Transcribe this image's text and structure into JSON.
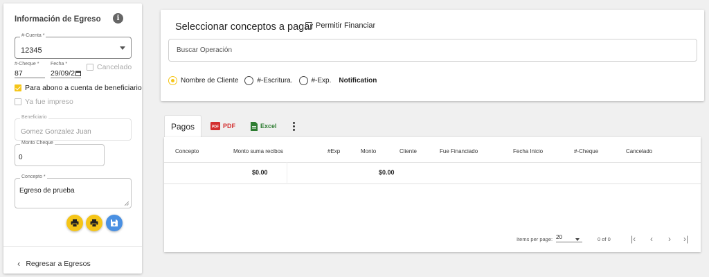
{
  "left_panel": {
    "title": "Información de Egreso",
    "info_icon": "info-circle-icon",
    "cuenta": {
      "label": "#-Cuenta *",
      "value": "12345"
    },
    "cheque": {
      "label": "#-Cheque *",
      "value": "87"
    },
    "fecha": {
      "label": "Fecha *",
      "value": "29/09/2"
    },
    "cancelado_label": "Cancelado",
    "abono_label": "Para abono a cuenta de beneficiario",
    "abono_checked": true,
    "impreso_label": "Ya fue impreso",
    "beneficiario": {
      "label": "Beneficiario",
      "value": "Gomez Gonzalez Juan"
    },
    "monto": {
      "label": "Monto Cheque",
      "value": "0"
    },
    "concepto": {
      "label": "Concepto *",
      "value": "Egreso de prueba"
    },
    "back_label": "Regresar a Egresos"
  },
  "top_card": {
    "title": "Seleccionar conceptos a pagar",
    "financiar_label": "Permitir Financiar",
    "search_placeholder": "Buscar Operación",
    "radios": [
      {
        "label": "Nombre de Cliente",
        "selected": true
      },
      {
        "label": "#-Escritura.",
        "selected": false
      },
      {
        "label": "#-Exp.",
        "selected": false
      }
    ],
    "notification_label": "Notification"
  },
  "tabs": {
    "pagos": "Pagos",
    "pdf": "PDF",
    "excel": "Excel"
  },
  "table": {
    "headers": [
      "Concepto",
      "Monto suma recibos",
      "#Exp",
      "Monto",
      "Cliente",
      "Fue Financiado",
      "Fecha Inicio",
      "#-Cheque",
      "Cancelado"
    ],
    "totals": {
      "monto_suma": "$0.00",
      "monto": "$0.00"
    },
    "pager": {
      "items_label": "Items per page:",
      "page_size": "20",
      "range": "0 of 0"
    }
  },
  "colors": {
    "accent": "#f5c518",
    "save": "#4a90e2",
    "pdf": "#d32f2f",
    "excel": "#2e7d32"
  }
}
